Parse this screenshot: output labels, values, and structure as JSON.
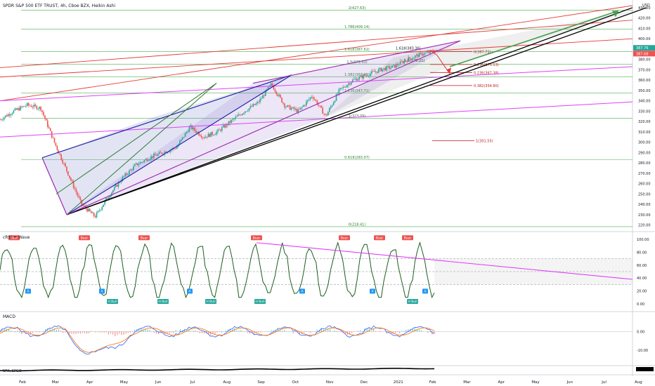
{
  "header": {
    "title": "SPDR S&P 500 ETF TRUST, 4h, Cboe BZX, Heikin Ashi",
    "currency": "USD"
  },
  "panes": {
    "crsi_label": "cRSI + Wave",
    "macd_label": "MACD",
    "spx_label": "SPX, SPGO"
  },
  "colors": {
    "bull": "#26a69a",
    "bear": "#ef5350",
    "purple": "#9c27b0",
    "magenta": "#e040fb",
    "blue": "#1a1aa6",
    "fib_green": "#4caf50",
    "black": "#000000",
    "red_line": "#e53935",
    "green_arrow": "#43a047"
  },
  "chart_data": [
    {
      "type": "line",
      "title": "SPDR S&P 500 ETF TRUST, 4h, Cboe BZX, Heikin Ashi",
      "x_ticks": [
        "Feb",
        "Mar",
        "Apr",
        "May",
        "Jun",
        "Jul",
        "Aug",
        "Sep",
        "Oct",
        "Nov",
        "Dec",
        "2021",
        "Feb",
        "Mar",
        "Apr",
        "May",
        "Jun",
        "Jul",
        "Aug"
      ],
      "y_ticks": [
        430,
        420,
        410,
        400,
        390,
        380,
        370,
        360,
        350,
        340,
        330,
        320,
        310,
        300,
        290,
        280,
        270,
        260,
        250,
        240,
        230,
        220
      ],
      "ylim": [
        215,
        432
      ],
      "price_labels": [
        "387.76",
        "387.68"
      ],
      "price_series_points": [
        [
          "Feb",
          322
        ],
        [
          "Feb",
          330
        ],
        [
          "Feb",
          336
        ],
        [
          "Mar",
          333
        ],
        [
          "Mar",
          300
        ],
        [
          "Mar",
          270
        ],
        [
          "Mar",
          240
        ],
        [
          "Mar",
          228
        ],
        [
          "Apr",
          248
        ],
        [
          "Apr",
          265
        ],
        [
          "Apr",
          278
        ],
        [
          "May",
          285
        ],
        [
          "May",
          290
        ],
        [
          "Jun",
          295
        ],
        [
          "Jun",
          315
        ],
        [
          "Jun",
          305
        ],
        [
          "Jul",
          310
        ],
        [
          "Jul",
          320
        ],
        [
          "Aug",
          330
        ],
        [
          "Aug",
          338
        ],
        [
          "Sep",
          356
        ],
        [
          "Sep",
          335
        ],
        [
          "Oct",
          330
        ],
        [
          "Oct",
          345
        ],
        [
          "Nov",
          325
        ],
        [
          "Nov",
          350
        ],
        [
          "Nov",
          360
        ],
        [
          "Dec",
          365
        ],
        [
          "Dec",
          370
        ],
        [
          "2021",
          373
        ],
        [
          "2021",
          380
        ],
        [
          "Feb",
          385
        ],
        [
          "Feb",
          387.7
        ]
      ],
      "fib_levels": [
        {
          "label": "2(427.63)",
          "value": 427.63
        },
        {
          "label": "1.786(409.14)",
          "value": 409.14
        },
        {
          "label": "1.618(387.62)",
          "value": 387.62
        },
        {
          "label": "1.5(375.33)",
          "value": 375.33
        },
        {
          "label": "1.382(363.02)",
          "value": 363.02
        },
        {
          "label": "1.236(347.71)",
          "value": 347.71
        },
        {
          "label": "1(323.09)",
          "value": 323.09
        },
        {
          "label": "0.618(283.07)",
          "value": 283.07
        },
        {
          "label": "0(218.41)",
          "value": 218.41
        }
      ],
      "short_fib_levels": [
        {
          "label": "0(387.71)",
          "value": 387.71
        },
        {
          "label": "0.236(375.13)",
          "value": 375.13
        },
        {
          "label": "0.236(367.38)",
          "value": 367.38
        },
        {
          "label": "0.382(354.80)",
          "value": 354.8
        },
        {
          "label": "1(301.55)",
          "value": 301.55
        }
      ],
      "small_labels": [
        "1.618(383.36)",
        "1.5(370.21)"
      ]
    },
    {
      "type": "line",
      "title": "cRSI + Wave",
      "y_ticks": [
        "100.00",
        "80.00",
        "60.00",
        "40.00",
        "20.00",
        "0.00"
      ],
      "ylim": [
        -10,
        110
      ],
      "signal_labels": [
        "Bear",
        "H Bull",
        "Bull",
        "A",
        "C"
      ]
    },
    {
      "type": "line",
      "title": "MACD",
      "y_ticks": [
        "0.00",
        "-10.00"
      ],
      "ylim": [
        -18,
        10
      ]
    },
    {
      "type": "line",
      "title": "SPX, SPGO",
      "y_ticks": [],
      "ylim": [
        0,
        1
      ]
    }
  ]
}
